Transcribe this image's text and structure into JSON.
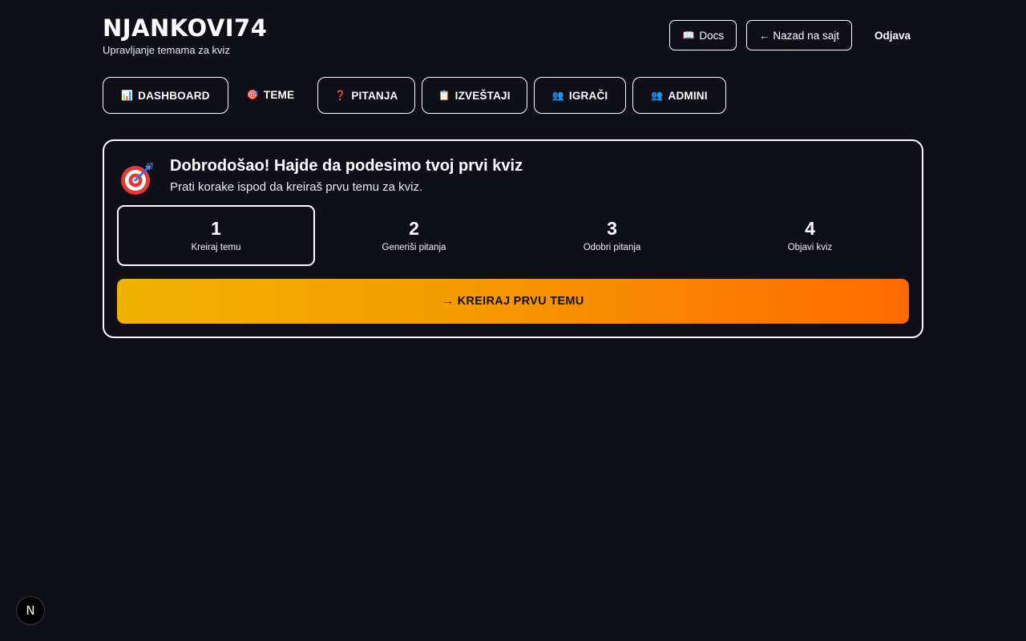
{
  "header": {
    "title": "NJANKOVI74",
    "subtitle": "Upravljanje temama za kviz",
    "actions": {
      "docs_icon": "📖",
      "docs_label": "Docs",
      "back_label": "← Nazad na sajt",
      "logout_label": "Odjava"
    }
  },
  "tabs": [
    {
      "icon": "📊",
      "icon_name": "bar-chart-icon",
      "label": "DASHBOARD",
      "active": false
    },
    {
      "icon": "🎯",
      "icon_name": "target-icon",
      "label": "TEME",
      "active": true
    },
    {
      "icon": "❓",
      "icon_name": "question-icon",
      "label": "PITANJA",
      "active": false
    },
    {
      "icon": "📋",
      "icon_name": "clipboard-icon",
      "label": "IZVEŠTAJI",
      "active": false
    },
    {
      "icon": "👥",
      "icon_name": "users-icon",
      "label": "IGRAČI",
      "active": false
    },
    {
      "icon": "👥",
      "icon_name": "users-icon",
      "label": "ADMINI",
      "active": false
    }
  ],
  "welcome": {
    "icon_name": "target-icon",
    "title": "Dobrodošao! Hajde da podesimo tvoj prvi kviz",
    "subtitle": "Prati korake ispod da kreiraš prvu temu za kviz.",
    "steps": [
      {
        "number": "1",
        "label": "Kreiraj temu",
        "active": true
      },
      {
        "number": "2",
        "label": "Generiši pitanja",
        "active": false
      },
      {
        "number": "3",
        "label": "Odobri pitanja",
        "active": false
      },
      {
        "number": "4",
        "label": "Objavi kviz",
        "active": false
      }
    ],
    "cta_label": "→ KREIRAJ PRVU TEMU"
  },
  "badge": {
    "letter": "N"
  },
  "colors": {
    "background": "#0f0f17",
    "cta_gradient_start": "#efb200",
    "cta_gradient_end": "#ff6a00",
    "border": "#ffffff"
  }
}
